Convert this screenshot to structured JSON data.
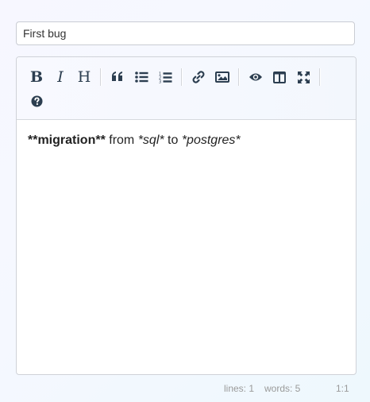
{
  "title_field": {
    "value": "First bug"
  },
  "toolbar": {
    "row1": [
      {
        "icon": "bold-icon",
        "glyph": "B"
      },
      {
        "icon": "italic-icon",
        "glyph": "I"
      },
      {
        "icon": "heading-icon",
        "glyph": "H"
      },
      {
        "icon": "quote-icon"
      },
      {
        "icon": "unordered-list-icon"
      },
      {
        "icon": "ordered-list-icon"
      },
      {
        "icon": "link-icon"
      },
      {
        "icon": "image-icon"
      },
      {
        "icon": "preview-icon"
      },
      {
        "icon": "side-by-side-icon"
      },
      {
        "icon": "fullscreen-icon"
      }
    ],
    "row2": [
      {
        "icon": "help-icon"
      }
    ]
  },
  "editor": {
    "content_parts": [
      {
        "text": "**migration**",
        "style": "strong"
      },
      {
        "text": " from ",
        "style": "plain"
      },
      {
        "text": "*sql*",
        "style": "em"
      },
      {
        "text": " to ",
        "style": "plain"
      },
      {
        "text": "*postgres*",
        "style": "em"
      }
    ]
  },
  "statusbar": {
    "lines_label": "lines: 1",
    "words_label": "words: 5",
    "cursor": "1:1"
  },
  "colors": {
    "icon": "#2c3e50",
    "border": "#cfd2d8",
    "status_text": "#9a9a9a"
  }
}
